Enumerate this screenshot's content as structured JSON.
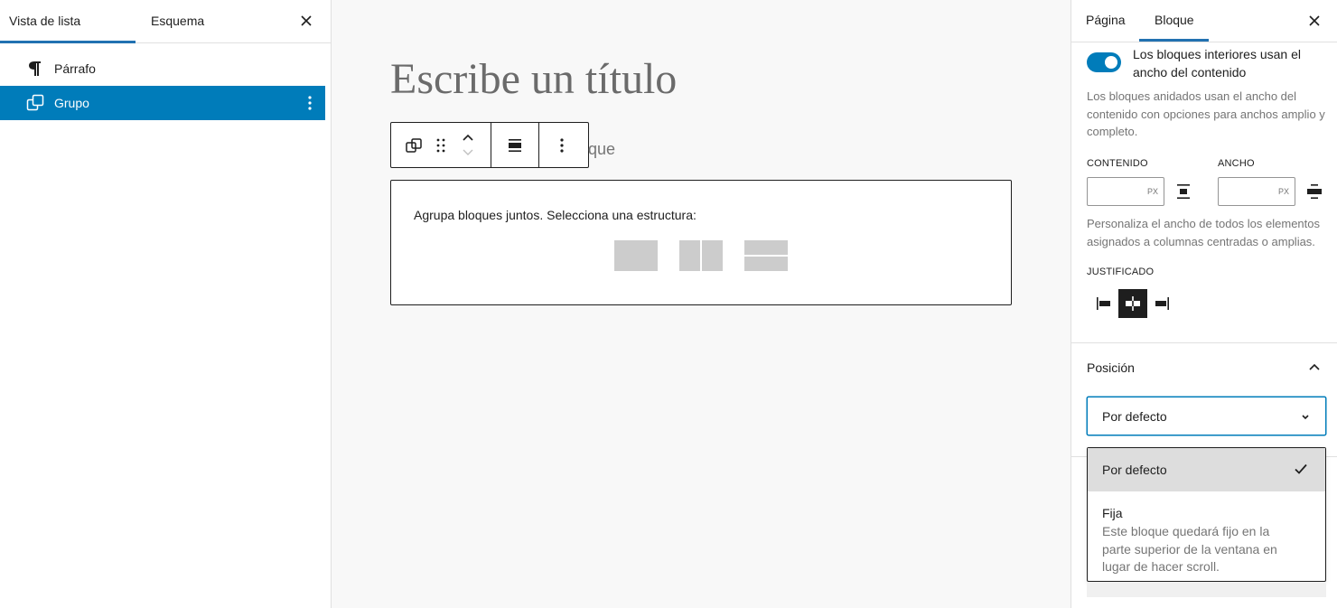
{
  "left_panel": {
    "tabs": [
      {
        "label": "Vista de lista"
      },
      {
        "label": "Esquema"
      }
    ],
    "items": [
      {
        "label": "Párrafo",
        "icon": "paragraph-icon"
      },
      {
        "label": "Grupo",
        "icon": "group-icon",
        "selected": true
      }
    ]
  },
  "canvas": {
    "title_placeholder": "Escribe un título",
    "after_toolbar_text": "que",
    "group_block": {
      "instructions": "Agrupa bloques juntos. Selecciona una estructura:",
      "variations": [
        "group-variation-icon",
        "row-variation-icon",
        "stack-variation-icon"
      ]
    }
  },
  "right_panel": {
    "tabs": [
      {
        "label": "Página"
      },
      {
        "label": "Bloque",
        "active": true
      }
    ],
    "layout": {
      "toggle_label": "Los bloques interiores usan el ancho del contenido",
      "toggle_on": true,
      "toggle_help": "Los bloques anidados usan el ancho del contenido con opciones para anchos amplio y completo.",
      "content_label": "CONTENIDO",
      "wide_label": "ANCHO",
      "unit": "PX",
      "width_help": "Personaliza el ancho de todos los elementos asignados a columnas centradas o amplias.",
      "justification_label": "JUSTIFICADO"
    },
    "position": {
      "title": "Posición",
      "selected": "Por defecto",
      "options": [
        {
          "label": "Por defecto",
          "checked": true
        },
        {
          "label": "Fija",
          "description": "Este bloque quedará fijo en la parte superior de la ventana en lugar de hacer scroll."
        }
      ]
    }
  },
  "colors": {
    "accent": "#007cba",
    "tab_indicator": "#2271b1",
    "text": "#1e1e1e",
    "muted": "#757575"
  }
}
